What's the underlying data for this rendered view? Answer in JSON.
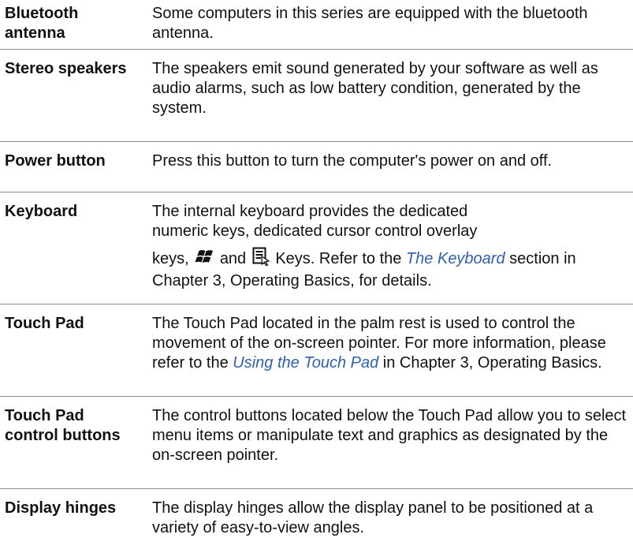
{
  "rows": [
    {
      "term": "Bluetooth antenna",
      "desc": "Some computers in this series are equipped with the bluetooth antenna."
    },
    {
      "term": "Stereo speakers",
      "desc": "The speakers emit sound generated by your software as well as audio alarms, such as low battery condition, generated by the system."
    },
    {
      "term": "Power button",
      "desc": "Press this button to turn the computer's power on and off."
    },
    {
      "term": "Keyboard",
      "desc_line1": "The internal keyboard provides the dedicated",
      "desc_line2": "numeric keys, dedicated cursor control overlay",
      "desc_keys": "keys,",
      "desc_and": "and",
      "desc_keys_after": "Keys. Refer to the",
      "link": "The Keyboard",
      "desc_tail": "section in Chapter 3, Operating Basics, for details.",
      "icons": [
        "windows-key-icon",
        "application-menu-key-icon"
      ]
    },
    {
      "term": "Touch Pad",
      "desc_before": "The Touch Pad located in the palm rest is used to control the movement of the on-screen pointer. For more information, please refer to the",
      "link": "Using the Touch Pad",
      "desc_after": "in Chapter 3, Operating Basics."
    },
    {
      "term": "Touch Pad control buttons",
      "desc": "The control buttons located below the Touch Pad allow you to select menu items or manipulate text and graphics as designated by the on-screen pointer."
    },
    {
      "term": "Display hinges",
      "desc": "The display hinges allow the display panel to be positioned at a variety of easy-to-view angles."
    }
  ],
  "colors": {
    "link": "#2f5fb0",
    "divider": "#8c8c8c",
    "text": "#111111"
  }
}
